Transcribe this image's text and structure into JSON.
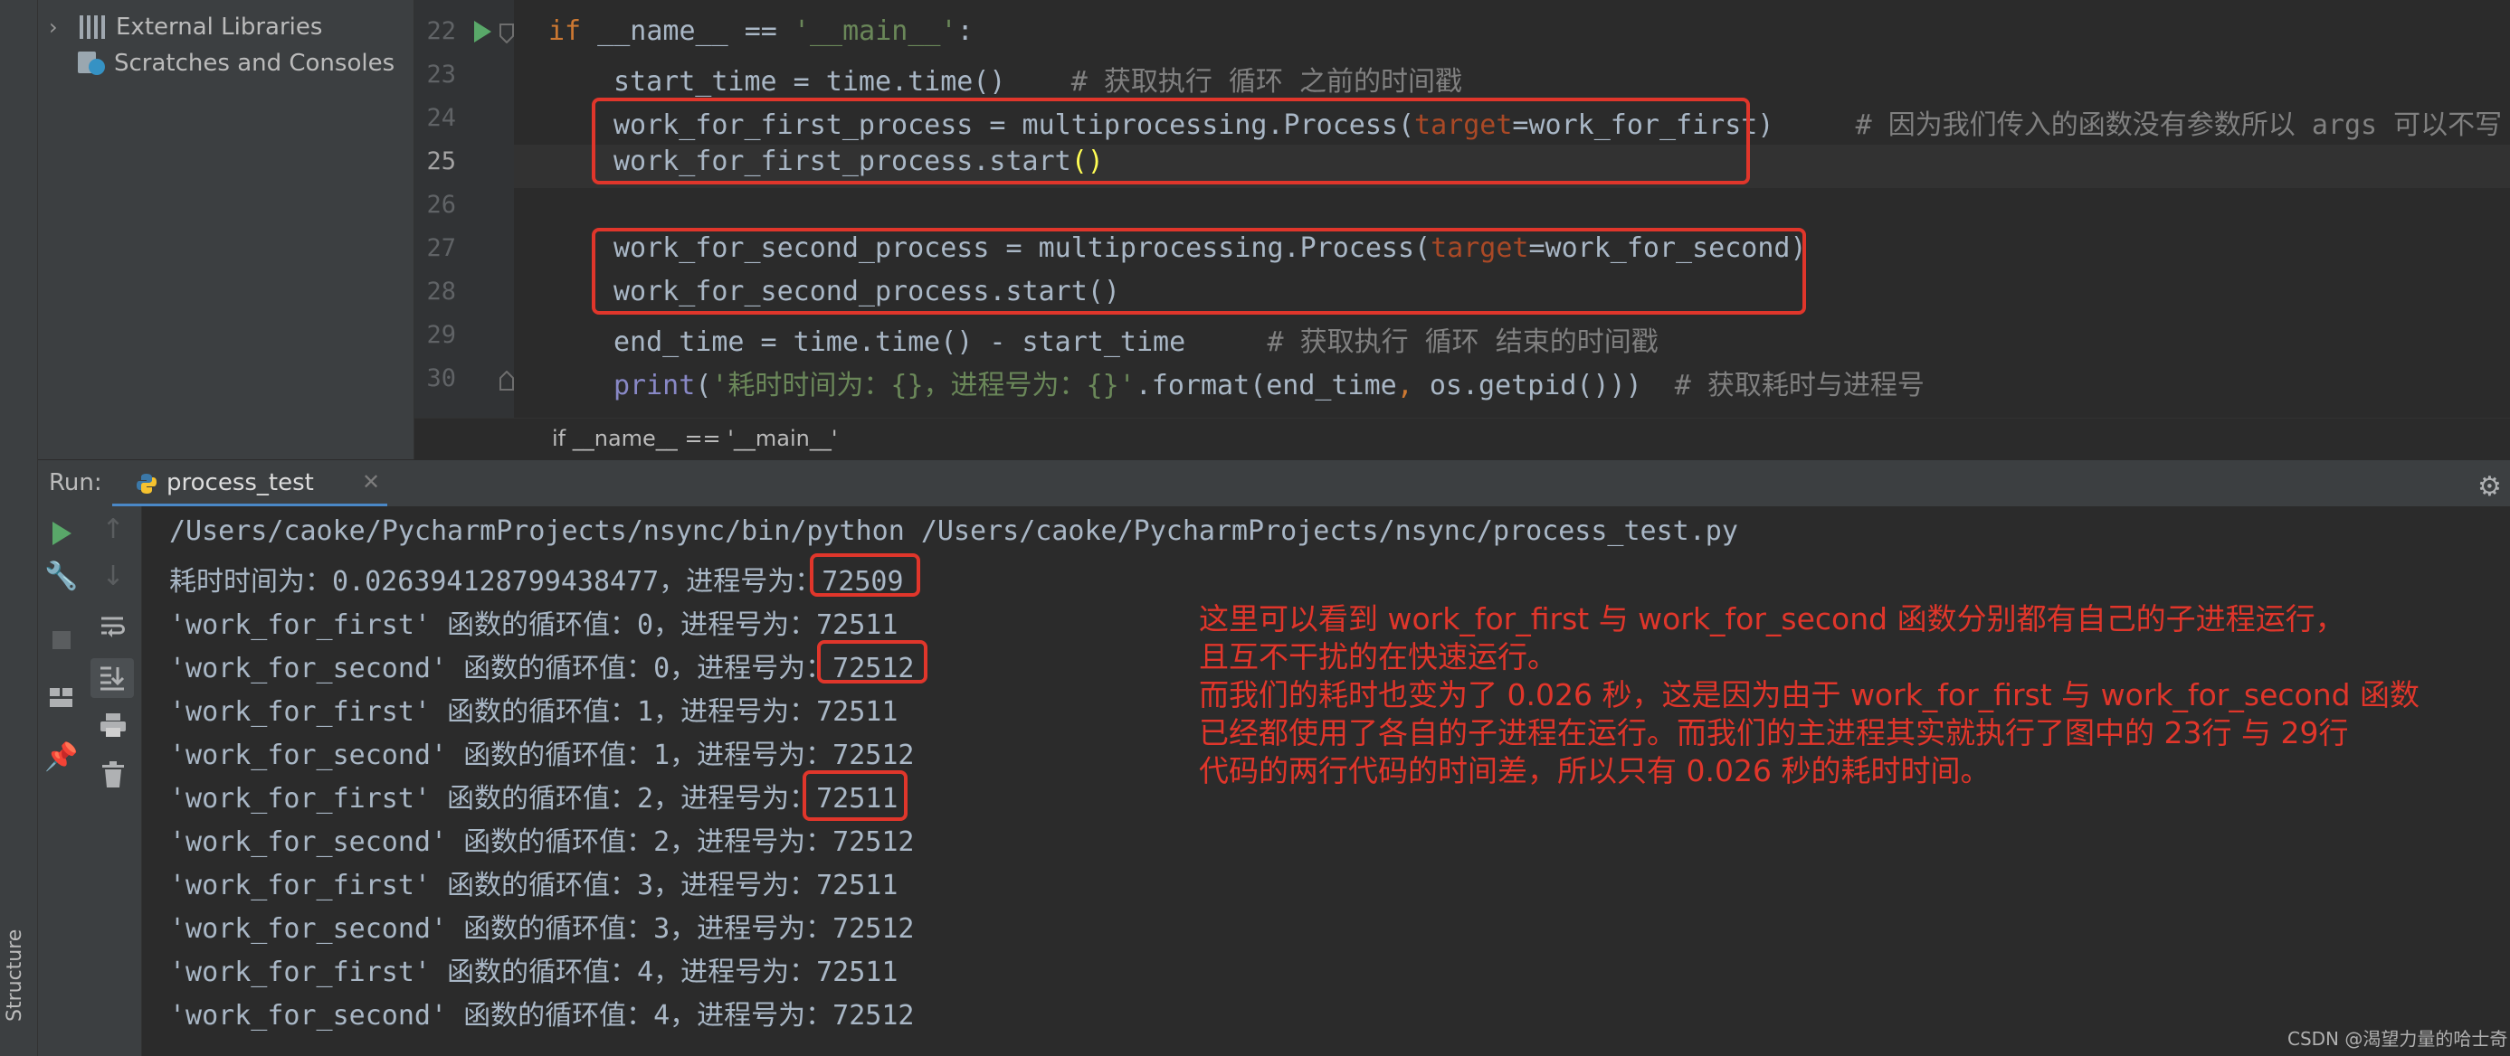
{
  "project_tree": {
    "items": [
      {
        "label": "External Libraries",
        "expanded": false
      },
      {
        "label": "Scratches and Consoles"
      }
    ]
  },
  "structure_tab": "Structure",
  "editor": {
    "lines": [
      {
        "num": "22",
        "code": "if __name__ == '__main__':"
      },
      {
        "num": "23",
        "code": "    start_time = time.time()    # 获取执行 循环 之前的时间戳"
      },
      {
        "num": "24",
        "code": "    work_for_first_process = multiprocessing.Process(target=work_for_first)     # 因为我们传入的函数没有参数所以 args 可以不写"
      },
      {
        "num": "25",
        "code": "    work_for_first_process.start()",
        "current": true
      },
      {
        "num": "26",
        "code": ""
      },
      {
        "num": "27",
        "code": "    work_for_second_process = multiprocessing.Process(target=work_for_second)"
      },
      {
        "num": "28",
        "code": "    work_for_second_process.start()"
      },
      {
        "num": "29",
        "code": "    end_time = time.time() - start_time     # 获取执行 循环 结束的时间戳"
      },
      {
        "num": "30",
        "code": "    print('耗时时间为：{}，进程号为：{}'.format(end_time, os.getpid()))  # 获取耗时与进程号"
      }
    ],
    "segments": {
      "l22_kw": "if",
      "l22_a": " __name__ == ",
      "l22_str": "'__main__'",
      "l22_b": ":",
      "l23_a": "start_time = time.time()",
      "l23_cm": "    # 获取执行 循环 之前的时间戳",
      "l24_a": "work_for_first_process = multiprocessing.Process(",
      "l24_param": "target",
      "l24_b": "=work_for_first)",
      "l24_cm": "     # 因为我们传入的函数没有参数所以 args 可以不写",
      "l25_a": "work_for_first_process.start",
      "l25_brk": "()",
      "l27_a": "work_for_second_process = multiprocessing.Process(",
      "l27_param": "target",
      "l27_b": "=work_for_second)",
      "l28_a": "work_for_second_process.start()",
      "l29_a": "end_time = time.time() - start_time",
      "l29_cm": "     # 获取执行 循环 结束的时间戳",
      "l30_bi": "print",
      "l30_a": "(",
      "l30_str": "'耗时时间为：{}，进程号为：{}'",
      "l30_b": ".format(end_time",
      "l30_comma": ",",
      "l30_c": " os.getpid()))",
      "l30_cm": "  # 获取耗时与进程号"
    },
    "breadcrumb": "if __name__ == '__main__'"
  },
  "run_panel": {
    "label": "Run:",
    "tab_label": "process_test",
    "icons": [
      "run-icon",
      "wrench-icon",
      "stop-icon",
      "layout-icon",
      "pin-icon",
      "up-arrow-icon",
      "down-arrow-icon",
      "soft-wrap-icon",
      "scroll-end-icon",
      "print-icon",
      "trash-icon",
      "settings-icon"
    ],
    "console_lines": [
      "/Users/caoke/PycharmProjects/nsync/bin/python /Users/caoke/PycharmProjects/nsync/process_test.py",
      "耗时时间为：0.026394128799438477，进程号为：72509",
      "'work_for_first' 函数的循环值：0，进程号为：72511",
      "'work_for_second' 函数的循环值：0，进程号为：72512",
      "'work_for_first' 函数的循环值：1，进程号为：72511",
      "'work_for_second' 函数的循环值：1，进程号为：72512",
      "'work_for_first' 函数的循环值：2，进程号为：72511",
      "'work_for_second' 函数的循环值：2，进程号为：72512",
      "'work_for_first' 函数的循环值：3，进程号为：72511",
      "'work_for_second' 函数的循环值：3，进程号为：72512",
      "'work_for_first' 函数的循环值：4，进程号为：72511",
      "'work_for_second' 函数的循环值：4，进程号为：72512"
    ]
  },
  "annotation": {
    "lines": [
      "这里可以看到 work_for_first 与 work_for_second 函数分别都有自己的子进程运行，",
      "且互不干扰的在快速运行。",
      "而我们的耗时也变为了 0.026 秒，这是因为由于 work_for_first 与 work_for_second 函数",
      "已经都使用了各自的子进程在运行。而我们的主进程其实就执行了图中的 23行 与 29行",
      "代码的两行代码的时间差，所以只有 0.026 秒的耗时时间。"
    ],
    "color": "#e0362b"
  },
  "watermark": "CSDN @渴望力量的哈士奇",
  "colors": {
    "background": "#2b2b2b",
    "panel": "#3c3f41",
    "keyword": "#cc7832",
    "string": "#6a8759",
    "comment": "#808080",
    "highlight_box": "#e0362b",
    "tab_underline": "#4a88c7"
  }
}
